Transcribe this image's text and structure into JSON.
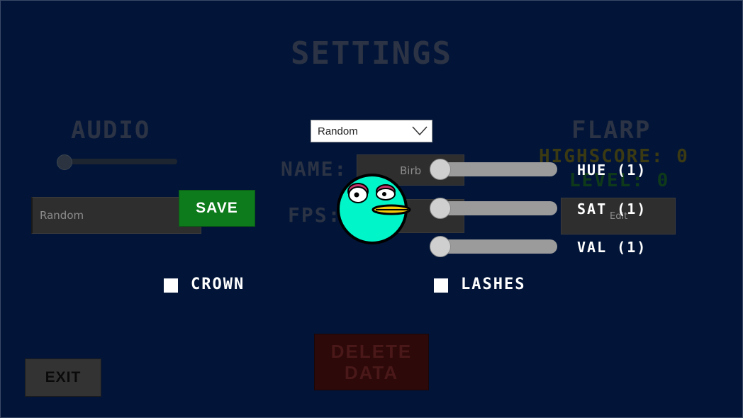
{
  "title": "SETTINGS",
  "audio": {
    "title": "AUDIO",
    "volume": 0.0
  },
  "seed": {
    "value": "Random"
  },
  "save_label": "SAVE",
  "mode_dropdown": {
    "selected": "Random"
  },
  "name": {
    "label": "NAME:",
    "value": "Birb"
  },
  "fps": {
    "label": "FPS:"
  },
  "flarp": {
    "title": "FLARP",
    "highscore": "HIGHSCORE: 0",
    "level": "LEVEL: 0"
  },
  "color_sliders": [
    {
      "label": "HUE (1)",
      "value": 0.0
    },
    {
      "label": "SAT (1)",
      "value": 0.0
    },
    {
      "label": "VAL (1)",
      "value": 0.0
    }
  ],
  "edit_field": {
    "value": "Edit"
  },
  "options": {
    "crown": "CROWN",
    "lashes": "LASHES"
  },
  "delete_label": [
    "DELETE",
    "DATA"
  ],
  "exit_label": "EXIT",
  "colors": {
    "background": "#021538",
    "save": "#0d7a1c",
    "bird_body": "#00f5c8",
    "beak": "#f2c90a",
    "delete": "#2d0909"
  }
}
